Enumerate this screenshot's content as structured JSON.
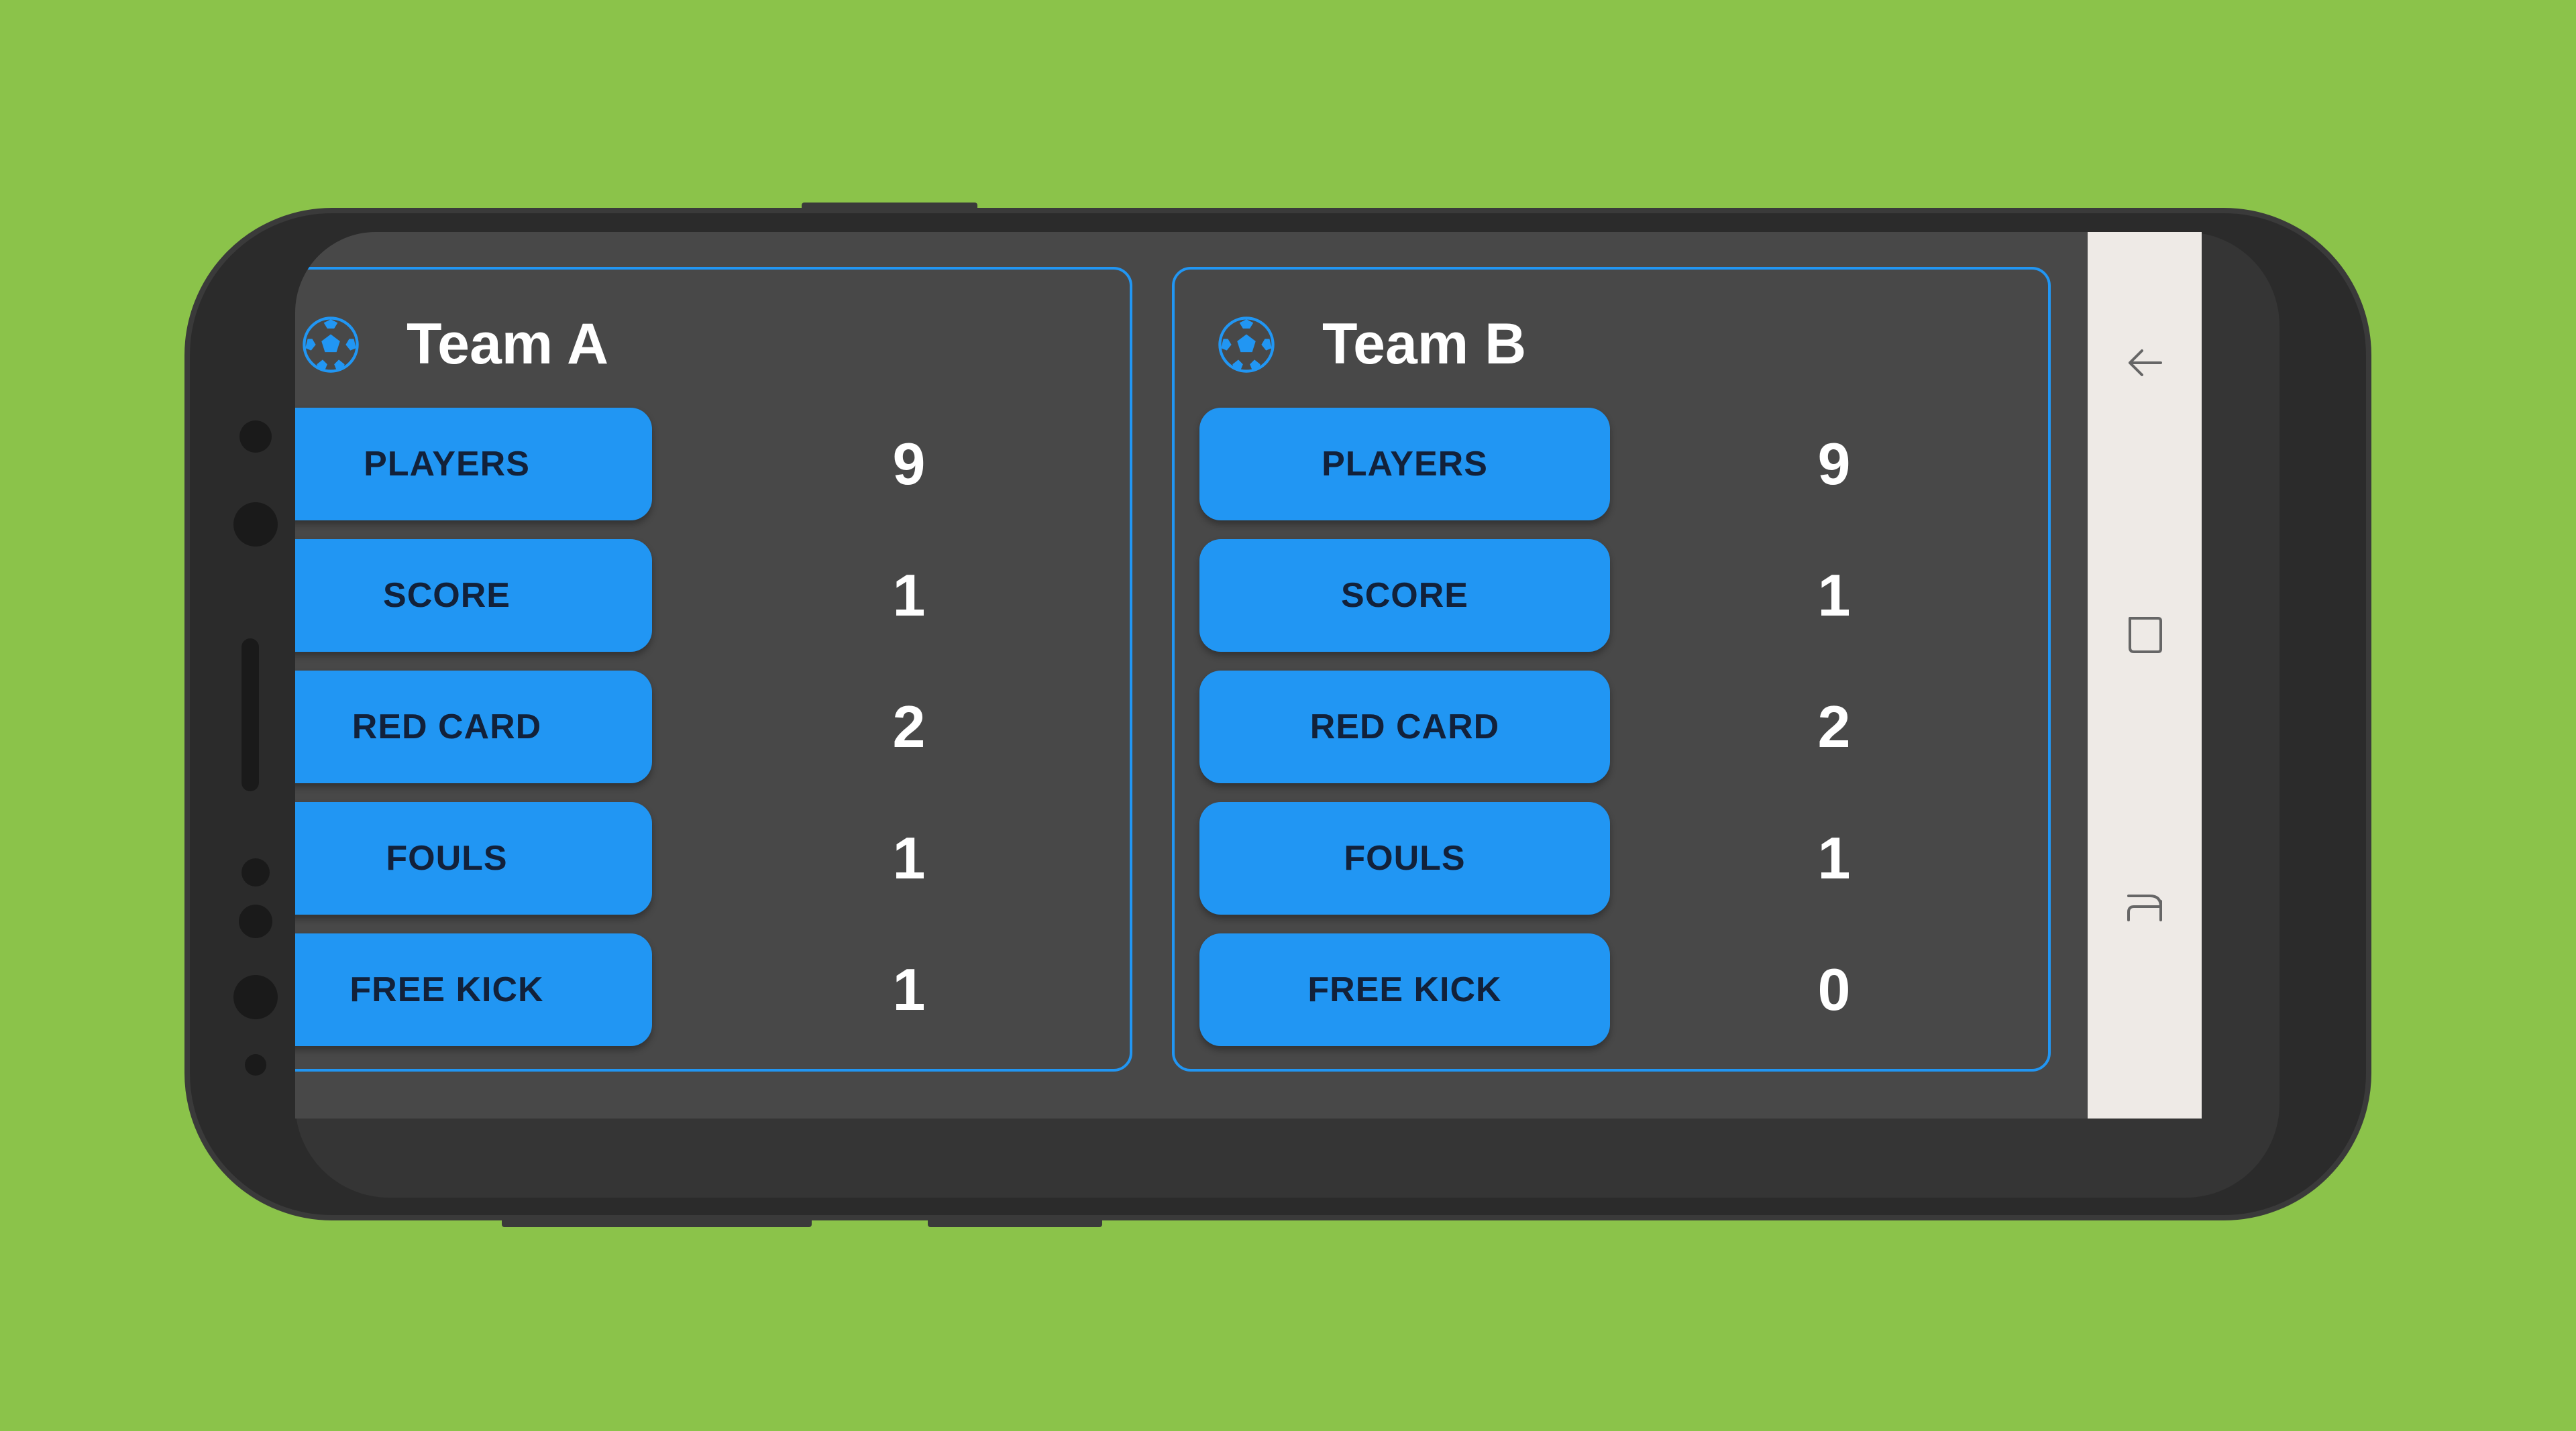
{
  "colors": {
    "background": "#8bc34a",
    "accent": "#2196f3",
    "screen": "#484848",
    "navbar": "#eeeae6"
  },
  "teams": [
    {
      "name": "Team A",
      "icon": "soccer-ball-icon",
      "stats": [
        {
          "label": "PLAYERS",
          "value": "9"
        },
        {
          "label": "SCORE",
          "value": "1"
        },
        {
          "label": "RED CARD",
          "value": "2"
        },
        {
          "label": "FOULS",
          "value": "1"
        },
        {
          "label": "FREE KICK",
          "value": "1"
        }
      ]
    },
    {
      "name": "Team B",
      "icon": "soccer-ball-icon",
      "stats": [
        {
          "label": "PLAYERS",
          "value": "9"
        },
        {
          "label": "SCORE",
          "value": "1"
        },
        {
          "label": "RED CARD",
          "value": "2"
        },
        {
          "label": "FOULS",
          "value": "1"
        },
        {
          "label": "FREE KICK",
          "value": "0"
        }
      ]
    }
  ],
  "navbar": {
    "icons": [
      "back-icon",
      "overview-icon",
      "recent-apps-icon"
    ]
  }
}
